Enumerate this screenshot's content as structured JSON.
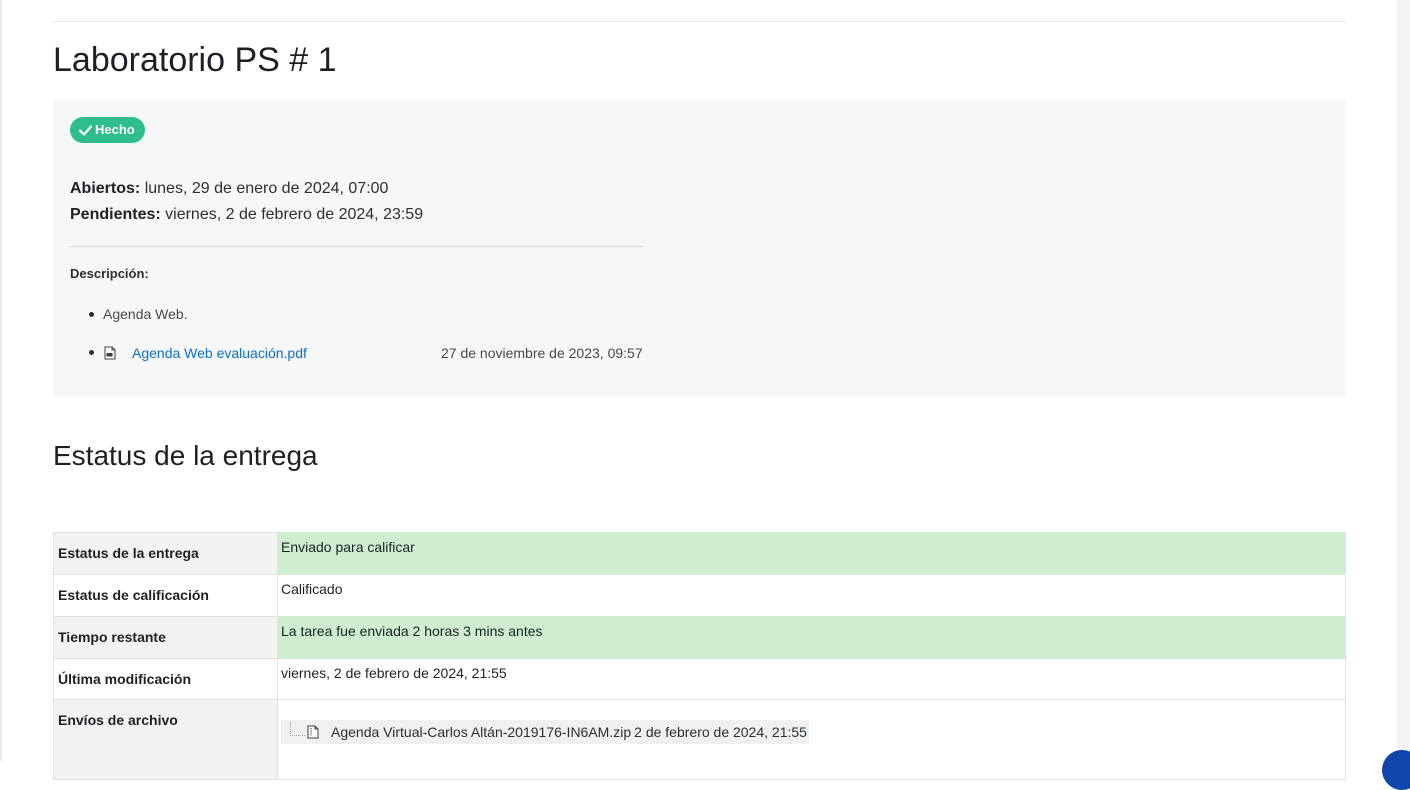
{
  "page": {
    "title": "Laboratorio PS # 1",
    "accent_color": "#0f6fc5",
    "success_color": "#2dbe8c"
  },
  "completion": {
    "badge_label": "Hecho",
    "badge_icon": "check-icon"
  },
  "dates": {
    "opened_label": "Abiertos:",
    "opened_value": "lunes, 29 de enero de 2024, 07:00",
    "due_label": "Pendientes:",
    "due_value": "viernes, 2 de febrero de 2024, 23:59"
  },
  "description": {
    "label": "Descripción:",
    "items": [
      "Agenda Web."
    ],
    "attachment": {
      "icon": "pdf-file-icon",
      "name": "Agenda Web evaluación.pdf",
      "date": "27 de noviembre de 2023, 09:57"
    }
  },
  "submission_status": {
    "heading": "Estatus de la entrega",
    "rows": [
      {
        "label": "Estatus de la entrega",
        "value": "Enviado para calificar"
      },
      {
        "label": "Estatus de calificación",
        "value": "Calificado"
      },
      {
        "label": "Tiempo restante",
        "value": "La tarea fue enviada 2 horas 3 mins antes"
      },
      {
        "label": "Última modificación",
        "value": "viernes, 2 de febrero de 2024, 21:55"
      },
      {
        "label": "Envíos de archivo",
        "file_icon": "zip-file-icon",
        "file_name": "Agenda Virtual-Carlos Altán-2019176-IN6AM.zip",
        "file_date": "2 de febrero de 2024, 21:55"
      }
    ]
  }
}
